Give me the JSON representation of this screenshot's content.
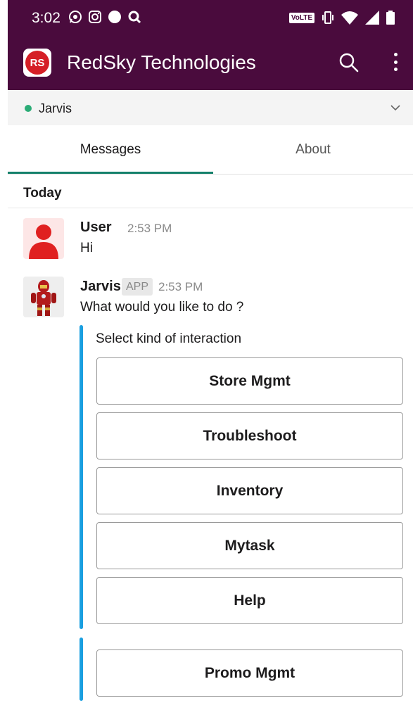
{
  "status_bar": {
    "time": "3:02",
    "left_icons": [
      "whatsapp-icon",
      "instagram-icon",
      "circle-icon",
      "q-icon"
    ],
    "volte": "VoLTE",
    "right_icons": [
      "vibrate-icon",
      "wifi-icon",
      "signal-icon",
      "battery-icon"
    ]
  },
  "app_bar": {
    "logo_text": "RS",
    "title": "RedSky Technologies",
    "background_color": "#4a0b3d"
  },
  "channel": {
    "name": "Jarvis",
    "presence_color": "#2bac76"
  },
  "tabs": [
    {
      "label": "Messages",
      "active": true
    },
    {
      "label": "About",
      "active": false
    }
  ],
  "day_divider": "Today",
  "messages": [
    {
      "sender": "User",
      "time": "2:53 PM",
      "text": "Hi",
      "avatar": "user-avatar-icon"
    },
    {
      "sender": "Jarvis",
      "badge": "APP",
      "time": "2:53 PM",
      "text": "What would you like to do ?",
      "avatar": "ironman-avatar"
    }
  ],
  "attachment": {
    "prompt": "Select kind of interaction",
    "accent_color": "#1a9fe0",
    "buttons": [
      "Store Mgmt",
      "Troubleshoot",
      "Inventory",
      "Mytask",
      "Help"
    ],
    "second_attachment_buttons": [
      "Promo Mgmt"
    ]
  }
}
